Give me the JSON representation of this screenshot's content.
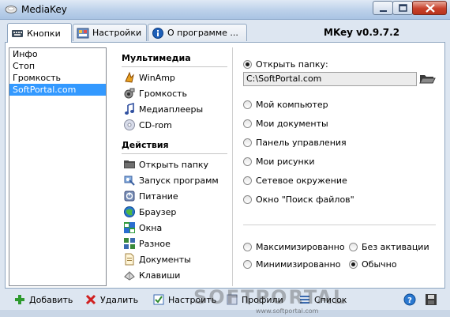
{
  "window": {
    "title": "MediaKey",
    "app_icon": "mouse-icon"
  },
  "tabs": [
    {
      "label": "Кнопки",
      "icon": "keyboard-icon",
      "active": true
    },
    {
      "label": "Настройки",
      "icon": "settings-panel-icon",
      "active": false
    },
    {
      "label": "О программе ...",
      "icon": "info-icon",
      "active": false
    }
  ],
  "version": "MKey v0.9.7.2",
  "key_list": {
    "items": [
      "Инфо",
      "Стоп",
      "Громкость",
      "SoftPortal.com"
    ],
    "selected_index": 3
  },
  "actions": {
    "multimedia_title": "Мультимедиа",
    "multimedia": [
      {
        "label": "WinAmp",
        "icon": "winamp-icon"
      },
      {
        "label": "Громкость",
        "icon": "speaker-icon"
      },
      {
        "label": "Медиаплееры",
        "icon": "music-note-icon"
      },
      {
        "label": "CD-rom",
        "icon": "cd-icon"
      }
    ],
    "actions_title": "Действия",
    "actions": [
      {
        "label": "Открыть папку",
        "icon": "folder-icon"
      },
      {
        "label": "Запуск программ",
        "icon": "program-icon"
      },
      {
        "label": "Питание",
        "icon": "power-icon"
      },
      {
        "label": "Браузер",
        "icon": "browser-icon"
      },
      {
        "label": "Окна",
        "icon": "windows-icon"
      },
      {
        "label": "Разное",
        "icon": "misc-icon"
      },
      {
        "label": "Документы",
        "icon": "document-icon"
      },
      {
        "label": "Клавиши",
        "icon": "keys-icon"
      }
    ]
  },
  "options": {
    "open_folder_label": "Открыть папку:",
    "open_folder_selected": true,
    "path_value": "C:\\SoftPortal.com",
    "locations": [
      "Мой компьютер",
      "Мои документы",
      "Панель управления",
      "Мои рисунки",
      "Сетевое окружение",
      "Окно \"Поиск файлов\""
    ],
    "window_modes": {
      "maximized": "Максимизированно",
      "no_activation": "Без активации",
      "minimized": "Минимизированно",
      "normal": "Обычно",
      "selected": "normal"
    }
  },
  "toolbar": {
    "add": "Добавить",
    "delete": "Удалить",
    "configure": "Настроить",
    "profiles": "Профили",
    "list": "Список"
  },
  "watermark": {
    "main": "SOFTPORTAL",
    "url": "www.softportal.com"
  }
}
